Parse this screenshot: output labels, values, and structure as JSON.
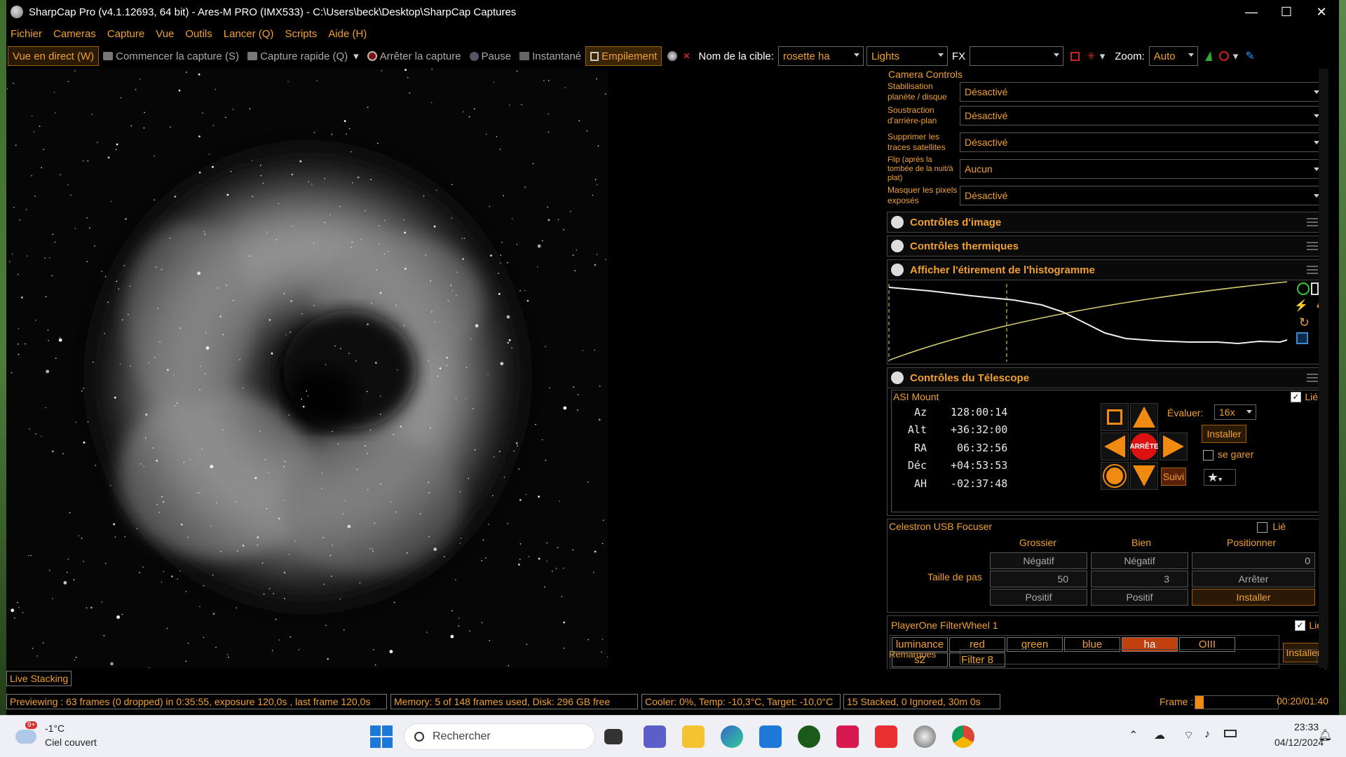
{
  "window": {
    "title": "SharpCap Pro (v4.1.12693, 64 bit) - Ares-M PRO (IMX533) - C:\\Users\\beck\\Desktop\\SharpCap Captures"
  },
  "menu": [
    "Fichier",
    "Cameras",
    "Capture",
    "Vue",
    "Outils",
    "Lancer (Q)",
    "Scripts",
    "Aide (H)"
  ],
  "toolbar": {
    "live_view": "Vue en direct (W)",
    "start_capture": "Commencer la capture (S)",
    "quick_capture": "Capture rapide (Q)",
    "stop_capture": "Arrêter la capture",
    "pause": "Pause",
    "snapshot": "Instantané",
    "stacking": "Empilement",
    "target_label": "Nom de la cible:",
    "target_value": "rosette ha",
    "frame_type": "Lights",
    "fx_label": "FX",
    "fx_value": "",
    "zoom_label": "Zoom:",
    "zoom_value": "Auto"
  },
  "camera_controls": {
    "header": "Camera Controls",
    "rows": [
      {
        "label": "Stabilisation planète / disque",
        "value": "Désactivé"
      },
      {
        "label": "Soustraction d'arrière-plan",
        "value": "Désactivé"
      },
      {
        "label": "Supprimer les traces satellites",
        "value": "Désactivé"
      },
      {
        "label": "Flip (après la tombée de la nuit/à plat)",
        "value": "Aucun"
      },
      {
        "label": "Masquer les pixels exposés",
        "value": "Désactivé"
      }
    ]
  },
  "sections": {
    "image_controls": "Contrôles d'image",
    "thermal_controls": "Contrôles thermiques",
    "histogram": "Afficher l'étirement de l'histogramme",
    "telescope": "Contrôles du Télescope"
  },
  "mount": {
    "name": "ASI Mount",
    "linked_label": "Lié",
    "az_label": "Az",
    "az": "128:00:14",
    "alt_label": "Alt",
    "alt": "+36:32:00",
    "ra_label": "RA",
    "ra": "06:32:56",
    "dec_label": "Déc",
    "dec": "+04:53:53",
    "ah_label": "AH",
    "ah": "-02:37:48",
    "rate_label": "Évaluer:",
    "rate_value": "16x",
    "install": "Installer",
    "park": "se garer",
    "track": "Suivi",
    "stop": "ARRÊTE"
  },
  "focuser": {
    "name": "Celestron USB Focuser",
    "linked_label": "Lié",
    "coarse": "Grossier",
    "fine": "Bien",
    "position": "Positionner",
    "negative": "Négatif",
    "positive": "Positif",
    "step_label": "Taille de pas",
    "coarse_step": "50",
    "fine_step": "3",
    "position_value": "0",
    "stop": "Arrêter",
    "install": "Installer"
  },
  "filterwheel": {
    "name": "PlayerOne FilterWheel 1",
    "linked_label": "Lié",
    "filters_row1": [
      "luminance",
      "red",
      "green",
      "blue",
      "ha",
      "OIII"
    ],
    "filters_row2": [
      "s2",
      "Filter 8"
    ],
    "selected": "ha",
    "install": "Installer"
  },
  "notes_label": "Remarques",
  "live_stacking_tab": "Live Stacking",
  "status": {
    "preview": "Previewing : 63 frames (0 dropped) in 0:35:55, exposure 120,0s , last frame 120,0s",
    "memory": "Memory: 5 of 148 frames used, Disk: 296 GB free",
    "cooler": "Cooler: 0%, Temp: -10,3°C, Target: -10,0°C",
    "stack": "15 Stacked, 0 Ignored, 30m 0s",
    "frame_label": "Frame :",
    "frame_progress": 0.1,
    "time": "00:20/01:40"
  },
  "taskbar": {
    "badge": "9+",
    "temperature": "-1°C",
    "weather": "Ciel couvert",
    "search_placeholder": "Rechercher",
    "clock_time": "23:33",
    "clock_date": "04/12/2024"
  },
  "colors": {
    "accent": "#f0a030",
    "selected_filter": "#c04010",
    "stop_red": "#dd1111"
  }
}
